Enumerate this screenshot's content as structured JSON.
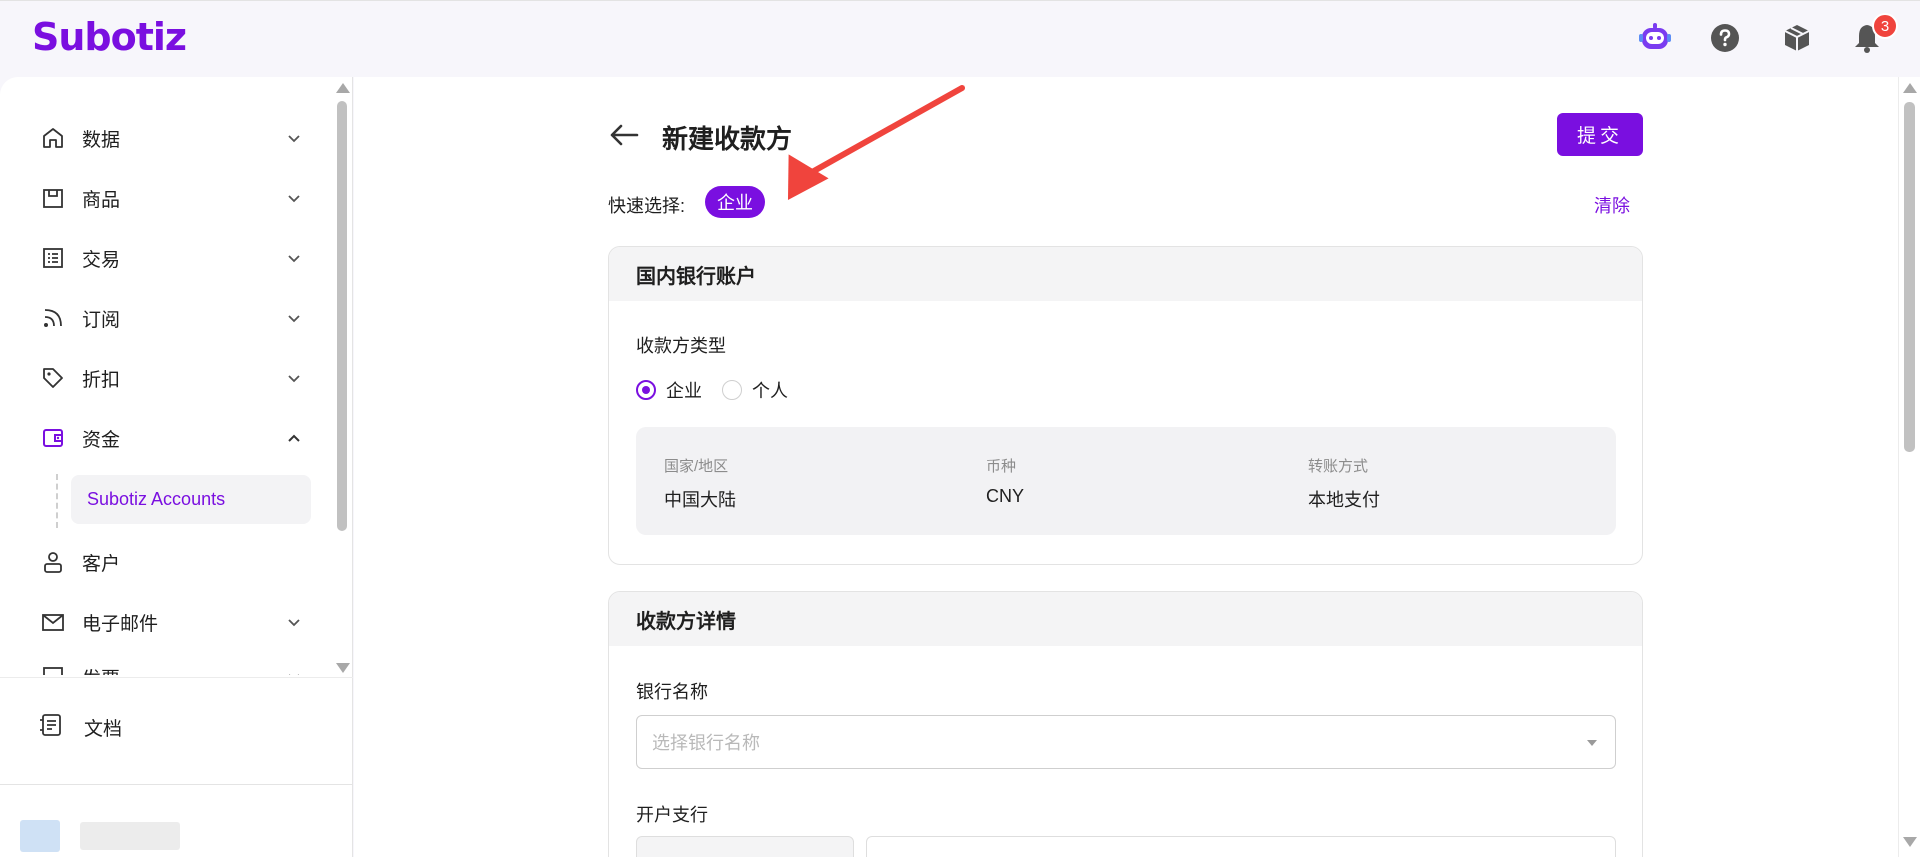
{
  "app": {
    "logo": "Subotiz",
    "notification_count": "3"
  },
  "sidebar": {
    "items": [
      {
        "label": "数据",
        "icon": "home-icon"
      },
      {
        "label": "商品",
        "icon": "store-icon"
      },
      {
        "label": "交易",
        "icon": "list-icon"
      },
      {
        "label": "订阅",
        "icon": "rss-icon"
      },
      {
        "label": "折扣",
        "icon": "tag-icon"
      },
      {
        "label": "资金",
        "icon": "wallet-icon"
      },
      {
        "label": "客户",
        "icon": "user-icon"
      },
      {
        "label": "电子邮件",
        "icon": "mail-icon"
      },
      {
        "label": "发票",
        "icon": "invoice-icon"
      }
    ],
    "sub_item": "Subotiz Accounts",
    "docs": "文档"
  },
  "page": {
    "title": "新建收款方",
    "submit": "提交",
    "quick_select_label": "快速选择:",
    "quick_select_tag": "企业",
    "clear": "清除"
  },
  "bank_card": {
    "title": "国内银行账户",
    "payee_type_label": "收款方类型",
    "options": [
      "企业",
      "个人"
    ],
    "selected": "企业",
    "info": {
      "country_label": "国家/地区",
      "country_value": "中国大陆",
      "currency_label": "币种",
      "currency_value": "CNY",
      "method_label": "转账方式",
      "method_value": "本地支付"
    }
  },
  "details_card": {
    "title": "收款方详情",
    "bank_name_label": "银行名称",
    "bank_name_placeholder": "选择银行名称",
    "branch_label": "开户支行"
  },
  "colors": {
    "accent": "#7a0fe0",
    "annotation": "#f0443d"
  }
}
